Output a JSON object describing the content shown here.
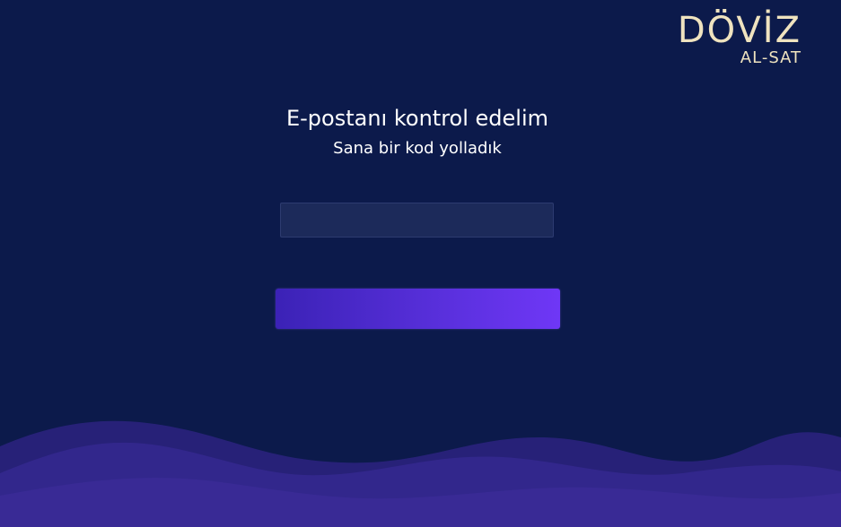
{
  "brand": {
    "name": "DÖVİZ",
    "tagline": "AL-SAT"
  },
  "verification": {
    "title": "E-postanı kontrol edelim",
    "subtitle": "Sana bir kod yolladık",
    "code_input": {
      "value": "",
      "placeholder": ""
    },
    "submit_label": ""
  },
  "colors": {
    "background": "#0c1a4b",
    "brand_text": "#efe3bf",
    "button_gradient_start": "#3b22b6",
    "button_gradient_end": "#6f37f6",
    "input_background": "#1c2a5a",
    "wave": "#3b2a8a"
  }
}
